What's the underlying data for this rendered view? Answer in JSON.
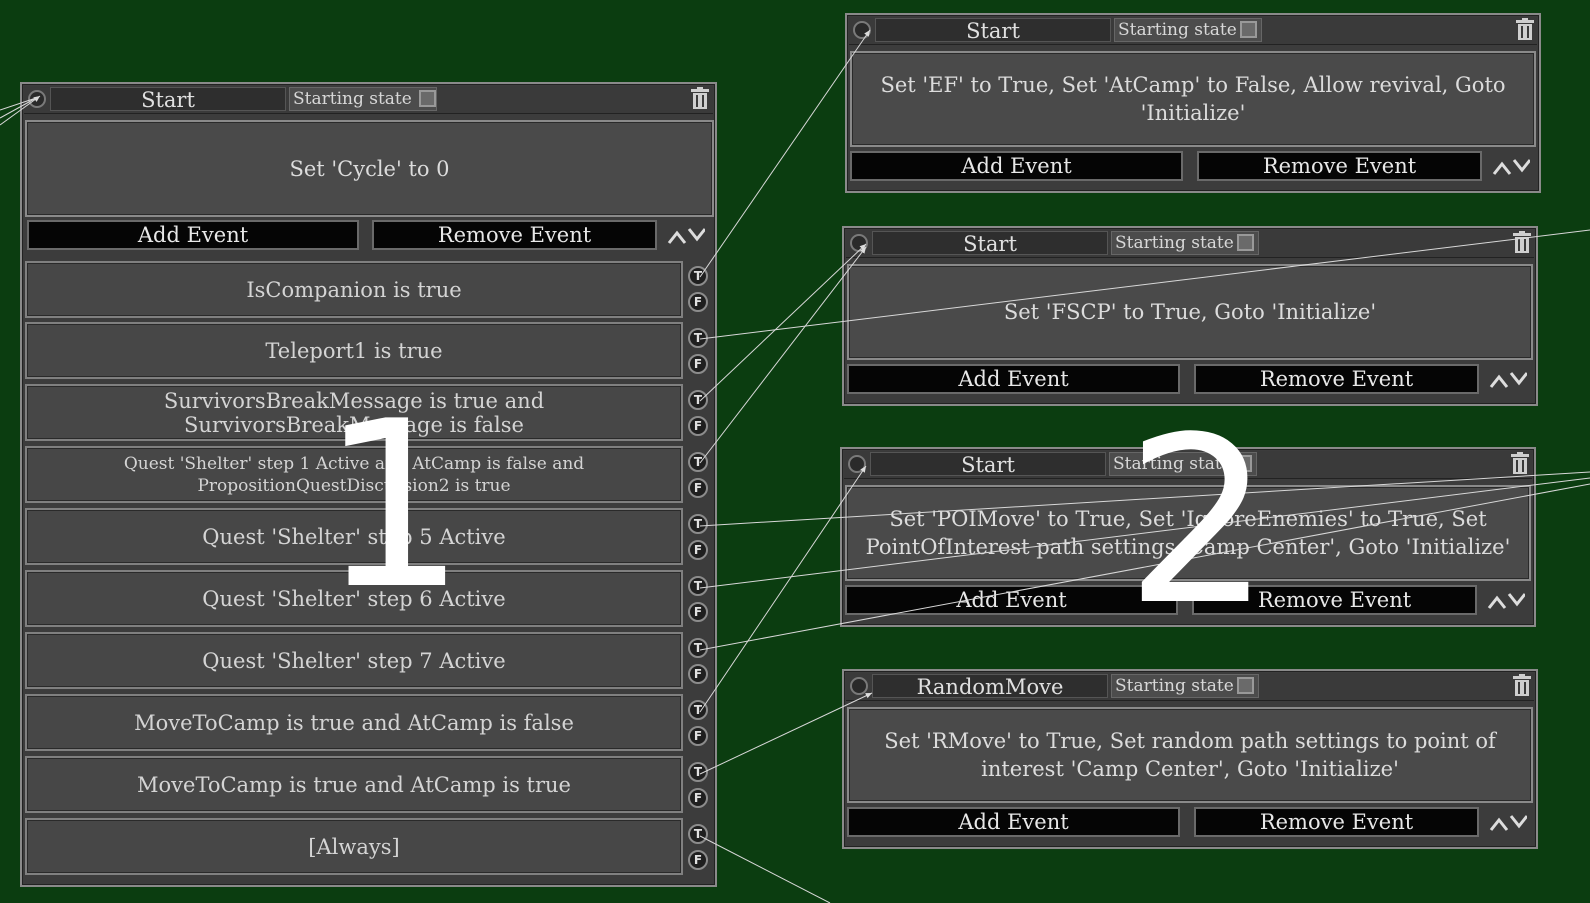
{
  "common": {
    "starting_state_label": "Starting state",
    "add_event_label": "Add Event",
    "remove_event_label": "Remove Event",
    "true_label": "T",
    "false_label": "F"
  },
  "main_node": {
    "title": "Start",
    "action": "Set 'Cycle' to 0",
    "events": [
      "IsCompanion is true",
      "Teleport1 is true",
      "SurvivorsBreakMessage is true and SurvivorsBreakMessage is false",
      "Quest 'Shelter' step 1 Active and AtCamp is false and PropositionQuestDiscussion2 is true",
      "Quest 'Shelter' step 5 Active",
      "Quest 'Shelter' step 6 Active",
      "Quest 'Shelter' step 7 Active",
      "MoveToCamp is true and AtCamp is false",
      "MoveToCamp is true and AtCamp is true",
      "[Always]"
    ]
  },
  "side_nodes": [
    {
      "title": "Start",
      "action": "Set 'EF' to True, Set 'AtCamp' to False, Allow revival, Goto 'Initialize'"
    },
    {
      "title": "Start",
      "action": "Set 'FSCP' to True, Goto 'Initialize'"
    },
    {
      "title": "Start",
      "action": "Set 'POIMove' to True, Set 'IgnoreEnemies' to True, Set PointOfInterest path settings 'Camp Center', Goto 'Initialize'"
    },
    {
      "title": "RandomMove",
      "action": "Set 'RMove' to True, Set random path settings to point of interest 'Camp Center', Goto 'Initialize'"
    }
  ],
  "annotations": {
    "label_1": "1",
    "label_2": "2"
  },
  "colors": {
    "background": "#0b3d10",
    "panel": "#3c3c3c",
    "button": "#050505",
    "wire": "#dcdcdc"
  }
}
